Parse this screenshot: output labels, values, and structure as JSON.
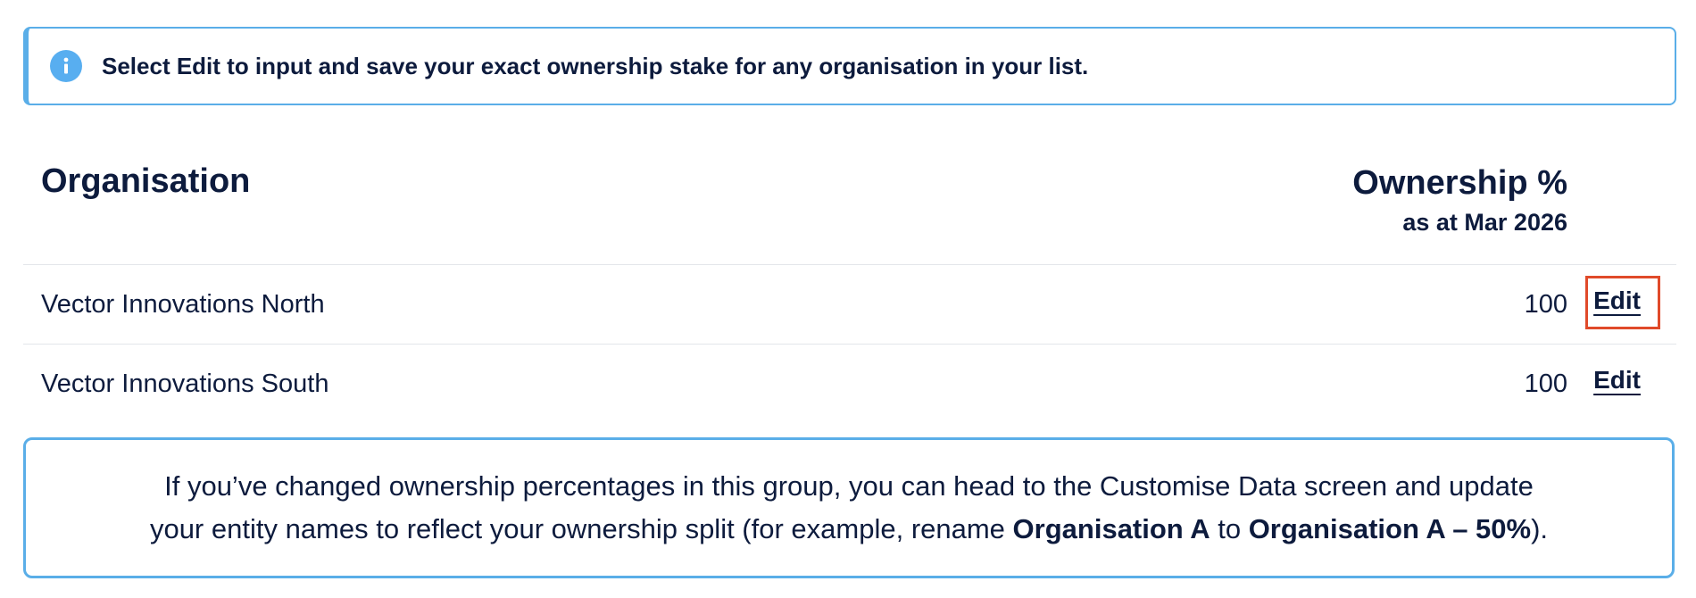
{
  "info_banner": {
    "icon": "info-icon",
    "text": "Select Edit to input and save your exact ownership stake for any organisation in your list."
  },
  "table": {
    "headers": {
      "organisation": "Organisation",
      "ownership": "Ownership %",
      "ownership_sub": "as at Mar 2026"
    },
    "rows": [
      {
        "organisation": "Vector Innovations North",
        "ownership": "100",
        "action": "Edit"
      },
      {
        "organisation": "Vector Innovations South",
        "ownership": "100",
        "action": "Edit"
      }
    ]
  },
  "note": {
    "line1": "If you’ve changed ownership percentages in this group, you can head to the Customise Data screen and update",
    "line2_prefix": "your entity names to reflect your ownership split (for example, rename ",
    "example_from": "Organisation A",
    "connector": " to ",
    "example_to": "Organisation A – 50%",
    "line2_suffix": ")."
  },
  "colors": {
    "accent_blue": "#5aaee8",
    "text_navy": "#0d1b3d",
    "highlight_red": "#e04a2a"
  }
}
